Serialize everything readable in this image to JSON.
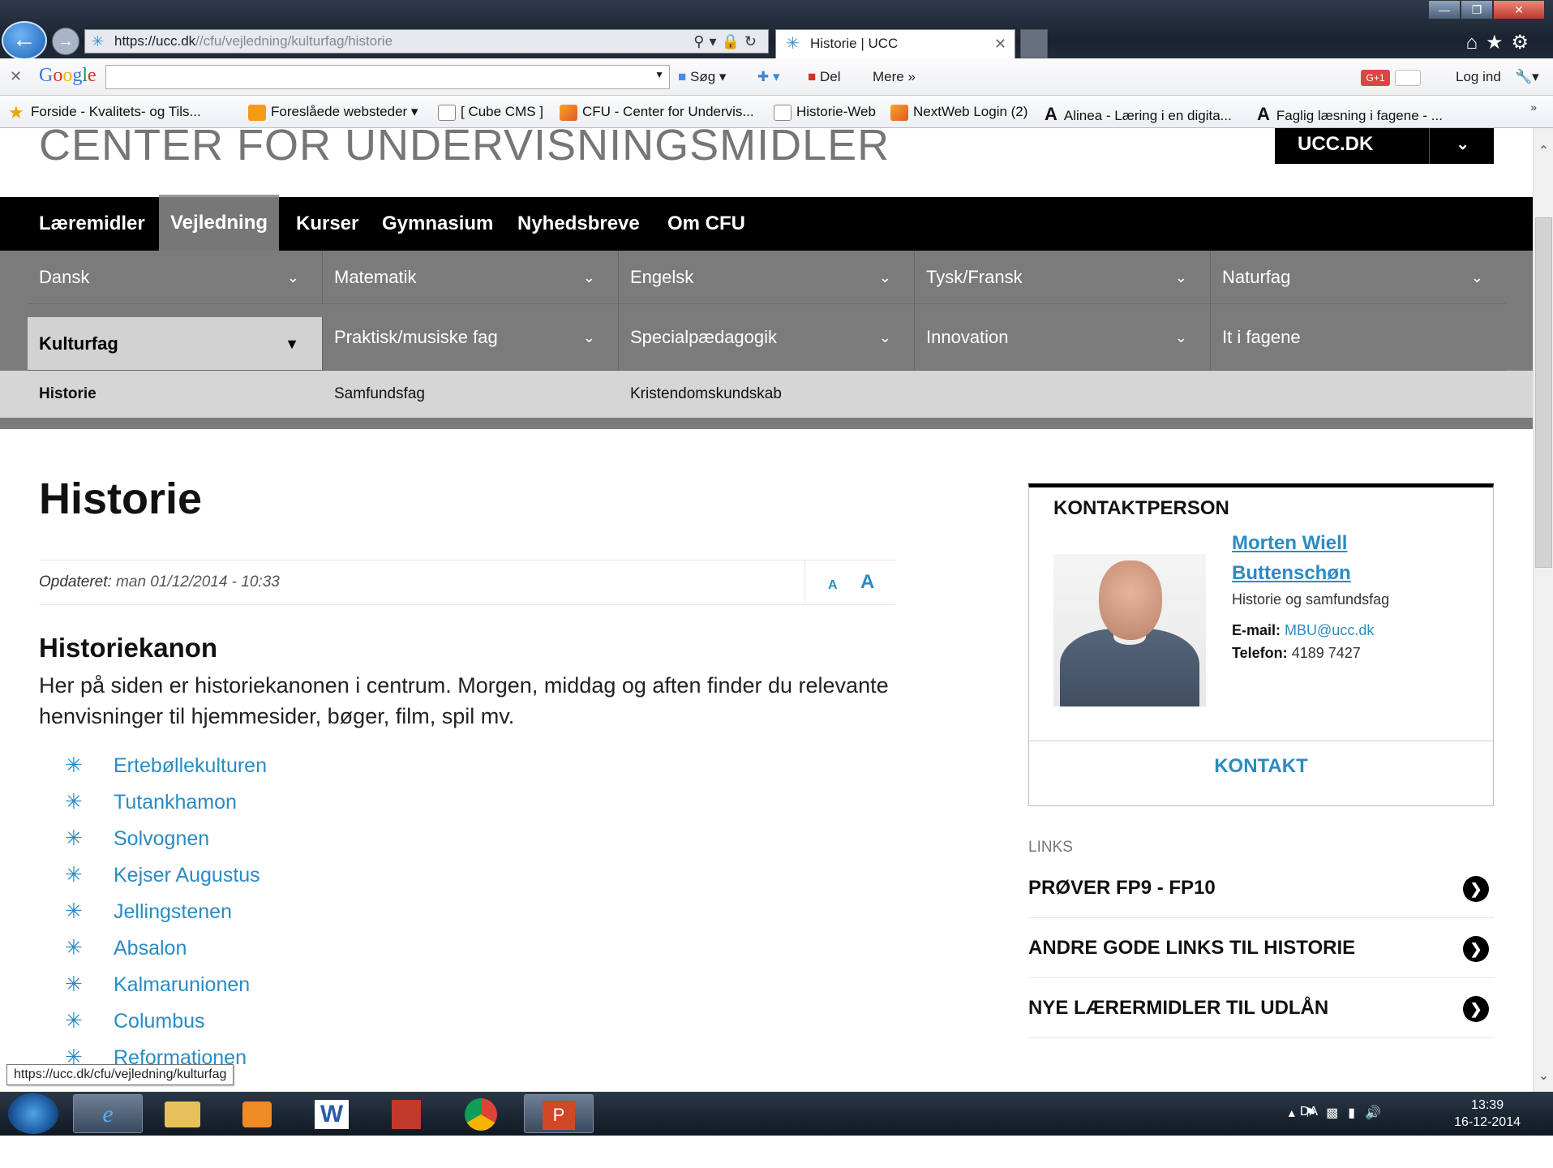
{
  "browser": {
    "url_host": "https://ucc.dk",
    "url_path": "//cfu/vejledning/kulturfag/historie",
    "tab_title": "Historie | UCC",
    "window_buttons": [
      "—",
      "❐",
      "✕"
    ]
  },
  "google_bar": {
    "logo": "Google",
    "search_label": "Søg",
    "share_label": "Del",
    "more_label": "Mere",
    "gplus": "G+1",
    "login_label": "Log ind"
  },
  "favorites": [
    {
      "label": "Forside - Kvalitets- og Tils...",
      "icon": "star"
    },
    {
      "label": "Foreslåede websteder ▾",
      "icon": "org"
    },
    {
      "label": "[ Cube  CMS ]",
      "icon": "page"
    },
    {
      "label": "CFU - Center for Undervis...",
      "icon": "cfu"
    },
    {
      "label": "Historie-Web",
      "icon": "page"
    },
    {
      "label": "NextWeb Login (2)",
      "icon": "cfu"
    },
    {
      "label": "Alinea - Læring i en digita...",
      "icon": "A"
    },
    {
      "label": "Faglig læsning i fagene - ...",
      "icon": "A"
    }
  ],
  "site": {
    "title": "CENTER FOR UNDERVISNINGSMIDLER",
    "ucc_label": "UCC.DK"
  },
  "main_nav": [
    {
      "label": "Læremidler",
      "active": false
    },
    {
      "label": "Vejledning",
      "active": true
    },
    {
      "label": "Kurser",
      "active": false
    },
    {
      "label": "Gymnasium",
      "active": false
    },
    {
      "label": "Nyhedsbreve",
      "active": false
    },
    {
      "label": "Om CFU",
      "active": false
    }
  ],
  "subjects_row1": [
    "Dansk",
    "Matematik",
    "Engelsk",
    "Tysk/Fransk",
    "Naturfag"
  ],
  "subjects_row2": [
    "Kulturfag",
    "Praktisk/musiske fag",
    "Specialpædagogik",
    "Innovation",
    "It i fagene"
  ],
  "subsubjects": [
    "Historie",
    "Samfundsfag",
    "Kristendomskundskab"
  ],
  "page": {
    "title": "Historie",
    "updated_label": "Opdateret:",
    "updated_value": " man 01/12/2014 - 10:33",
    "font_small": "A",
    "font_large": "A",
    "section_title": "Historiekanon",
    "intro": "Her på siden er historiekanonen i centrum. Morgen, middag og aften finder du relevante henvisninger til hjemmesider, bøger, film, spil mv.",
    "kanon_items": [
      "Ertebøllekulturen",
      "Tutankhamon",
      "Solvognen",
      "Kejser Augustus",
      "Jellingstenen",
      "Absalon",
      "Kalmarunionen",
      "Columbus",
      "Reformationen"
    ]
  },
  "contact": {
    "title": "KONTAKTPERSON",
    "name_line1": "Morten Wiell",
    "name_line2": "Buttenschøn",
    "role": "Historie og samfundsfag",
    "email_label": "E-mail:",
    "email": "MBU@ucc.dk",
    "phone_label": "Telefon:",
    "phone": "4189 7427",
    "button": "KONTAKT"
  },
  "links": {
    "label": "LINKS",
    "items": [
      "PRØVER FP9 - FP10",
      "ANDRE GODE LINKS TIL HISTORIE",
      "NYE LÆRERMIDLER TIL UDLÅN"
    ]
  },
  "status_url": "https://ucc.dk/cfu/vejledning/kulturfag",
  "taskbar": {
    "lang": "DA",
    "time": "13:39",
    "date": "16-12-2014"
  },
  "colors": {
    "accent": "#2b8bc4",
    "nav_black": "#000000",
    "subnav_grey": "#7b7b7b"
  }
}
